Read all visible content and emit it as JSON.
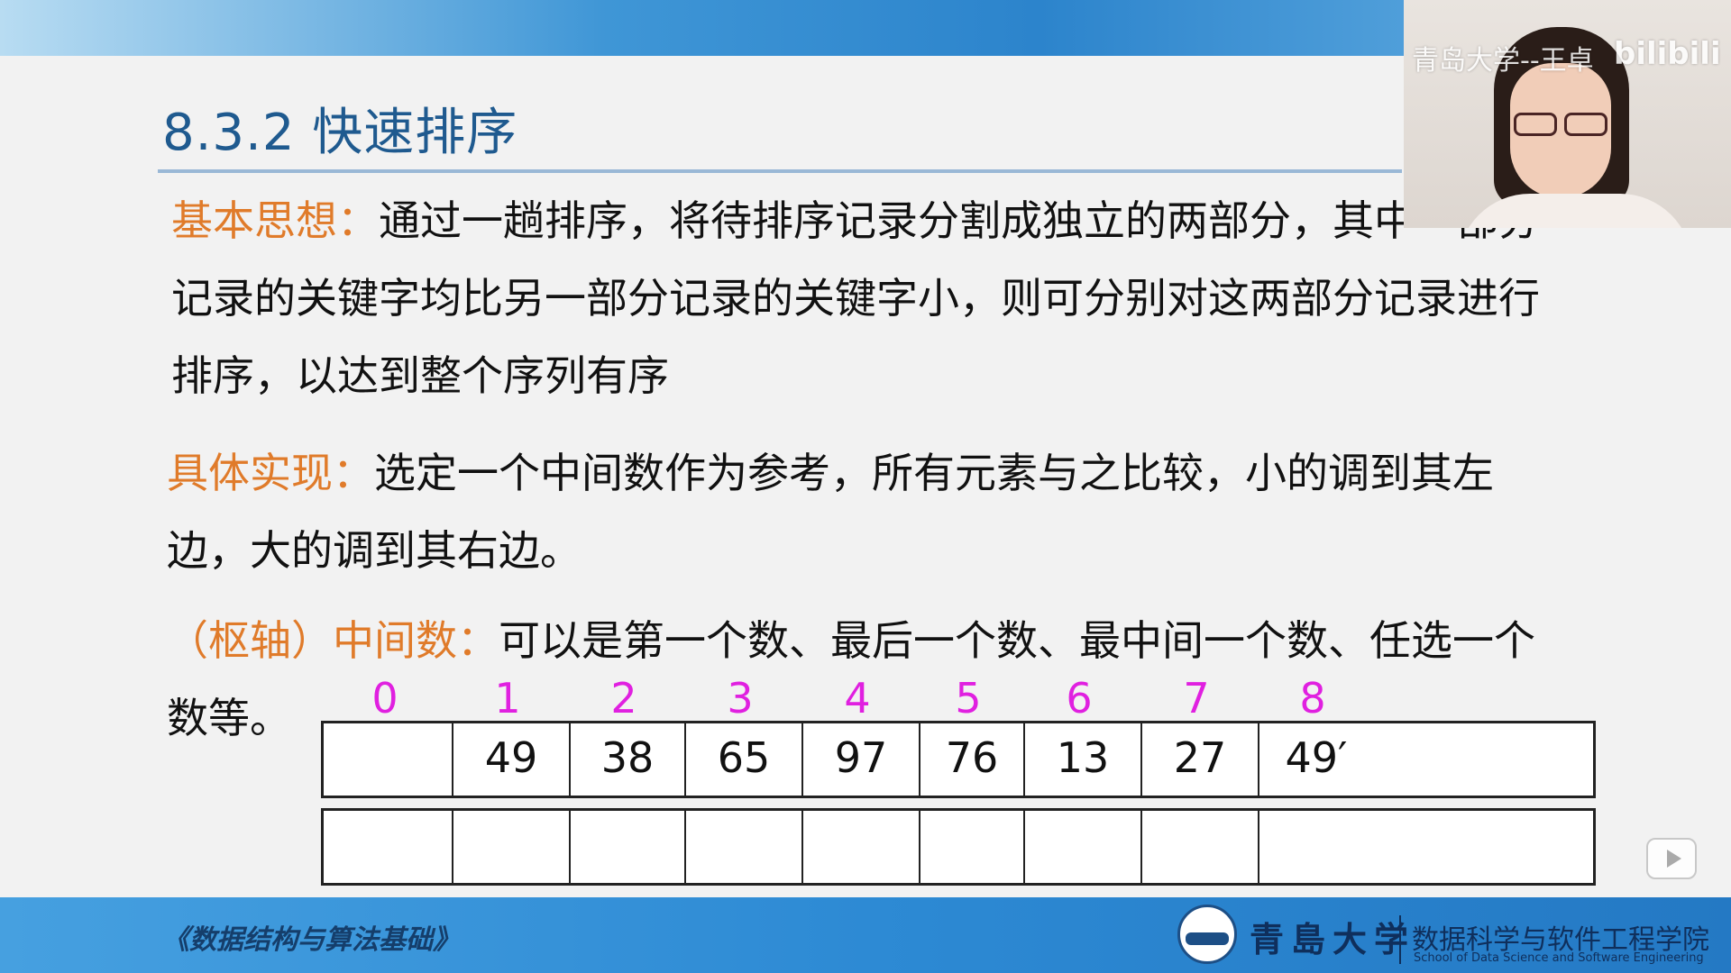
{
  "slide": {
    "title": "8.3.2  快速排序",
    "basic_label": "基本思想：",
    "basic_text": "通过一趟排序，将待排序记录分割成独立的两部分，其中一部分记录的关键字均比另一部分记录的关键字小，则可分别对这两部分记录进行排序，以达到整个序列有序",
    "impl_label": "具体实现：",
    "impl_text": "选定一个中间数作为参考，所有元素与之比较，小的调到其左边，大的调到其右边。",
    "pivot_label": "（枢轴）中间数：",
    "pivot_text": "可以是第一个数、最后一个数、最中间一个数、任选一个数等。"
  },
  "array": {
    "indices": [
      "0",
      "1",
      "2",
      "3",
      "4",
      "5",
      "6",
      "7",
      "8"
    ],
    "values": [
      "",
      "49",
      "38",
      "65",
      "97",
      "76",
      "13",
      "27",
      "49′"
    ],
    "empty_row": [
      "",
      "",
      "",
      "",
      "",
      "",
      "",
      "",
      ""
    ]
  },
  "footer": {
    "course_title": "《数据结构与算法基础》",
    "university": "青島大学",
    "school": "数据科学与软件工程学院",
    "school_english": "School of Data Science and Software Engineering"
  },
  "overlay": {
    "webcam_caption": "青岛大学--王卓",
    "platform_logo": "bilibili"
  },
  "colors": {
    "title": "#1f5a8f",
    "label": "#e07b2a",
    "index": "#e020e0",
    "band": "#2c84cc"
  }
}
